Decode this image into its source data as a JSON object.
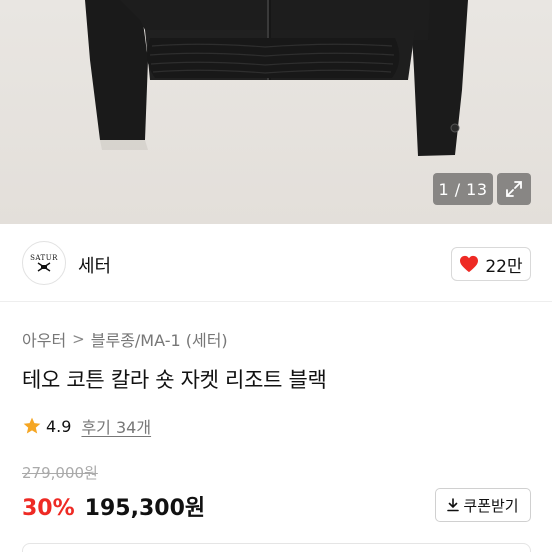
{
  "gallery": {
    "counter": "1 / 13",
    "expand_icon": "expand-icon"
  },
  "brand": {
    "logo_text": "SATUR",
    "name": "세터",
    "like_icon": "heart-icon",
    "like_color": "#ee2a24",
    "likes": "22만"
  },
  "product": {
    "breadcrumb": [
      "아우터",
      "블루종/MA-1 (세터)"
    ],
    "title": "테오 코튼 칼라 숏 자켓 리조트 블랙",
    "rating": "4.9",
    "star_color": "#f5a623",
    "reviews": "후기 34개",
    "original_price": "279,000원",
    "discount": "30%",
    "discount_color": "#ee2a24",
    "sale_price": "195,300원",
    "coupon_label": "쿠폰받기",
    "coupon_icon": "download-icon"
  }
}
